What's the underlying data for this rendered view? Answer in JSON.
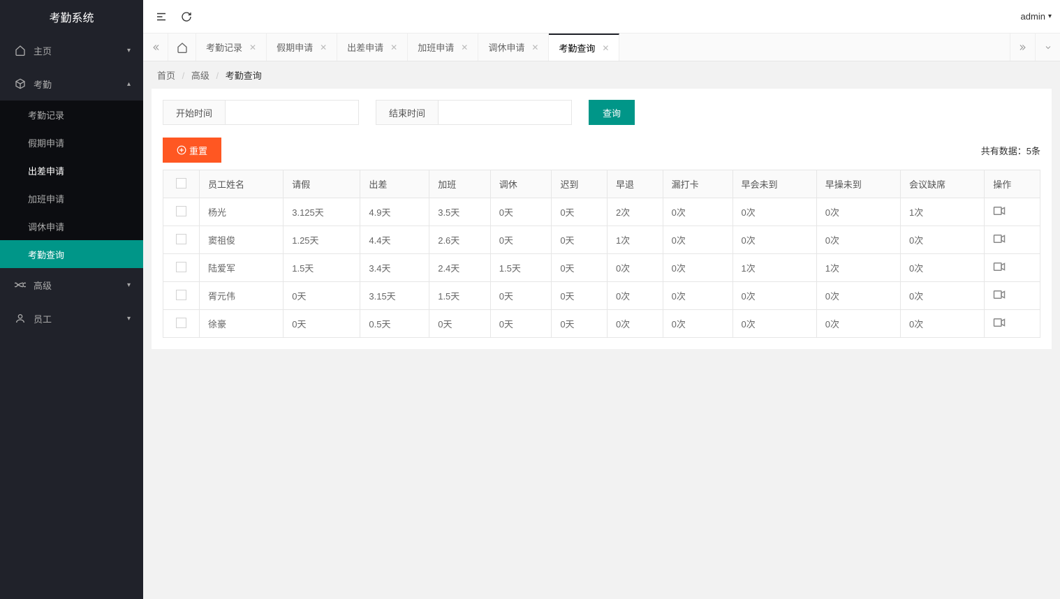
{
  "app_title": "考勤系统",
  "user_name": "admin",
  "sidebar": {
    "items": [
      {
        "label": "主页",
        "icon": "home",
        "expanded": false
      },
      {
        "label": "考勤",
        "icon": "cube",
        "expanded": true,
        "children": [
          {
            "label": "考勤记录"
          },
          {
            "label": "假期申请"
          },
          {
            "label": "出差申请",
            "selected": true
          },
          {
            "label": "加班申请"
          },
          {
            "label": "调休申请"
          },
          {
            "label": "考勤查询",
            "active": true
          }
        ]
      },
      {
        "label": "高级",
        "icon": "infinity",
        "expanded": false
      },
      {
        "label": "员工",
        "icon": "user",
        "expanded": false
      }
    ]
  },
  "tabs": [
    {
      "label": "考勤记录"
    },
    {
      "label": "假期申请"
    },
    {
      "label": "出差申请"
    },
    {
      "label": "加班申请"
    },
    {
      "label": "调休申请"
    },
    {
      "label": "考勤查询",
      "active": true
    }
  ],
  "breadcrumb": {
    "home": "首页",
    "mid": "高级",
    "current": "考勤查询"
  },
  "filters": {
    "start_label": "开始时间",
    "end_label": "结束时间",
    "search_label": "查询",
    "reset_label": "重置"
  },
  "data_count_prefix": "共有数据：",
  "data_count_value": "5条",
  "table": {
    "headers": [
      "员工姓名",
      "请假",
      "出差",
      "加班",
      "调休",
      "迟到",
      "早退",
      "漏打卡",
      "早会未到",
      "早操未到",
      "会议缺席",
      "操作"
    ],
    "rows": [
      {
        "name": "杨光",
        "leave": "3.125天",
        "trip": "4.9天",
        "ot": "3.5天",
        "rest": "0天",
        "late": "0天",
        "early": "2次",
        "miss": "0次",
        "morn": "0次",
        "exer": "0次",
        "meet": "1次"
      },
      {
        "name": "窦祖俊",
        "leave": "1.25天",
        "trip": "4.4天",
        "ot": "2.6天",
        "rest": "0天",
        "late": "0天",
        "early": "1次",
        "miss": "0次",
        "morn": "0次",
        "exer": "0次",
        "meet": "0次"
      },
      {
        "name": "陆爱军",
        "leave": "1.5天",
        "trip": "3.4天",
        "ot": "2.4天",
        "rest": "1.5天",
        "late": "0天",
        "early": "0次",
        "miss": "0次",
        "morn": "1次",
        "exer": "1次",
        "meet": "0次"
      },
      {
        "name": "胥元伟",
        "leave": "0天",
        "trip": "3.15天",
        "ot": "1.5天",
        "rest": "0天",
        "late": "0天",
        "early": "0次",
        "miss": "0次",
        "morn": "0次",
        "exer": "0次",
        "meet": "0次"
      },
      {
        "name": "徐豪",
        "leave": "0天",
        "trip": "0.5天",
        "ot": "0天",
        "rest": "0天",
        "late": "0天",
        "early": "0次",
        "miss": "0次",
        "morn": "0次",
        "exer": "0次",
        "meet": "0次"
      }
    ]
  }
}
